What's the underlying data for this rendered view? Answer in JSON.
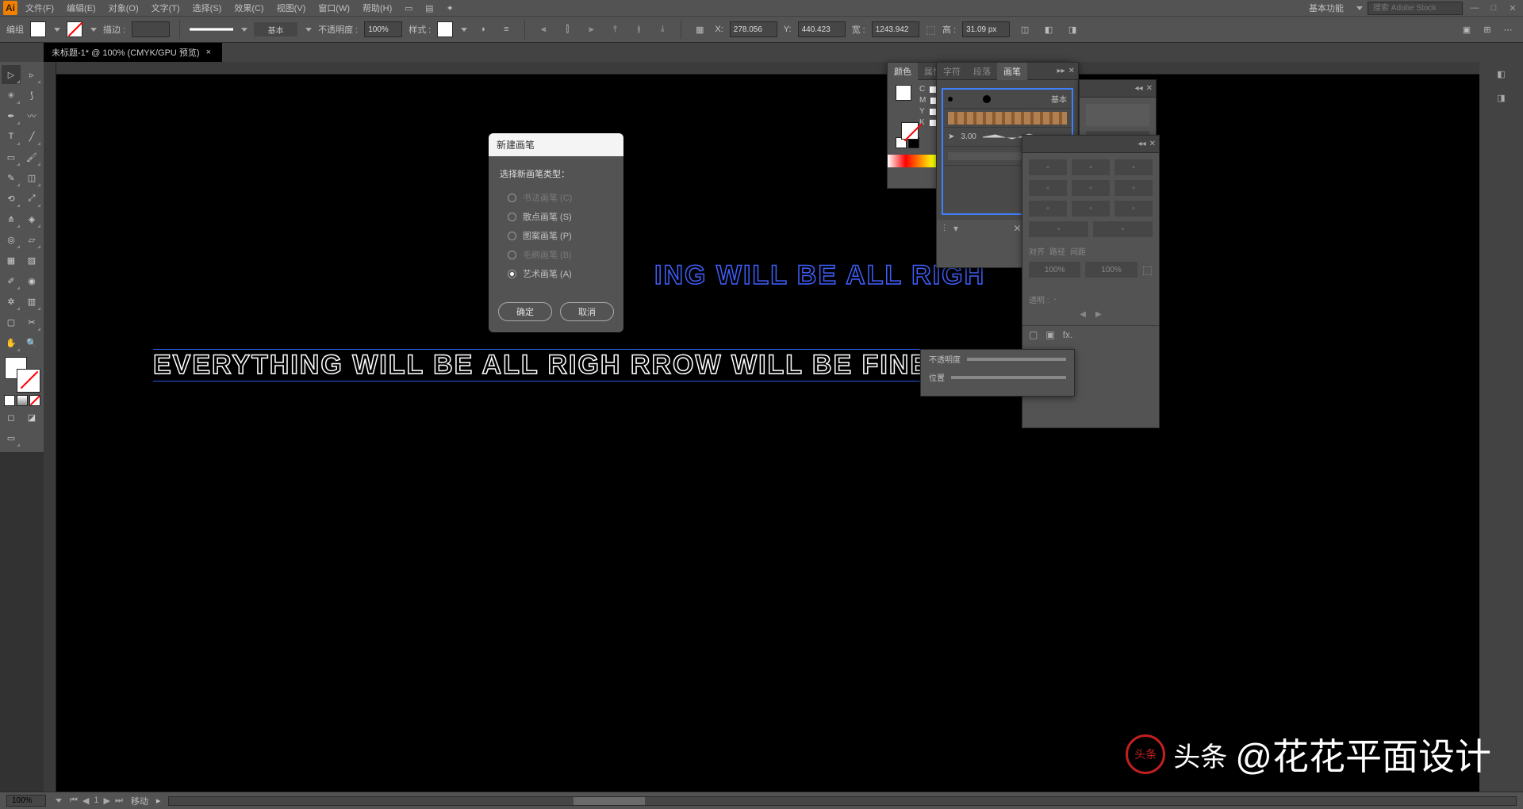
{
  "menubar": {
    "items": [
      "文件(F)",
      "编辑(E)",
      "对象(O)",
      "文字(T)",
      "选择(S)",
      "效果(C)",
      "视图(V)",
      "窗口(W)",
      "帮助(H)"
    ],
    "workspace": "基本功能",
    "stock_placeholder": "搜索 Adobe Stock"
  },
  "controlbar": {
    "mode": "编组",
    "stroke_label": "描边 :",
    "stroke_weight": "",
    "brush_def": "基本",
    "opacity_label": "不透明度 :",
    "opacity": "100%",
    "style_label": "样式 :",
    "x_label": "X:",
    "x": "278.056",
    "y_label": "Y:",
    "y": "440.423",
    "w_label": "宽 :",
    "w": "1243.942",
    "h_label": "高 :",
    "h": "31.09 px"
  },
  "document": {
    "tab": "未标题-1* @ 100% (CMYK/GPU 预览)",
    "text_blue": "ING WILL BE ALL RIGH",
    "text_white": "EVERYTHING WILL BE ALL RIGH       RROW WILL BE FINE"
  },
  "dialog": {
    "title": "新建画笔",
    "label": "选择新画笔类型：",
    "options": [
      {
        "label": "书法画笔 (C)",
        "enabled": false,
        "checked": false
      },
      {
        "label": "散点画笔 (S)",
        "enabled": true,
        "checked": false
      },
      {
        "label": "图案画笔 (P)",
        "enabled": true,
        "checked": false
      },
      {
        "label": "毛刷画笔 (B)",
        "enabled": false,
        "checked": false
      },
      {
        "label": "艺术画笔 (A)",
        "enabled": true,
        "checked": true
      }
    ],
    "ok": "确定",
    "cancel": "取消"
  },
  "panels": {
    "color": {
      "tabs": [
        "颜色",
        "属性"
      ],
      "channels": [
        "C",
        "M",
        "Y",
        "K"
      ]
    },
    "brushes": {
      "tabs": [
        "字符",
        "段落",
        "画笔"
      ],
      "basic": "基本",
      "callig_val": "3.00"
    },
    "transform": {
      "percent": "100%",
      "transparent_label": "透明 :",
      "tabs": [
        "对齐",
        "路径",
        "间距"
      ]
    },
    "more": {
      "labels": [
        "不透明度",
        "位置"
      ]
    }
  },
  "statusbar": {
    "zoom": "100%",
    "artboard": "1",
    "tool": "移动"
  },
  "watermark": {
    "brand": "头条",
    "credit": "@花花平面设计"
  }
}
